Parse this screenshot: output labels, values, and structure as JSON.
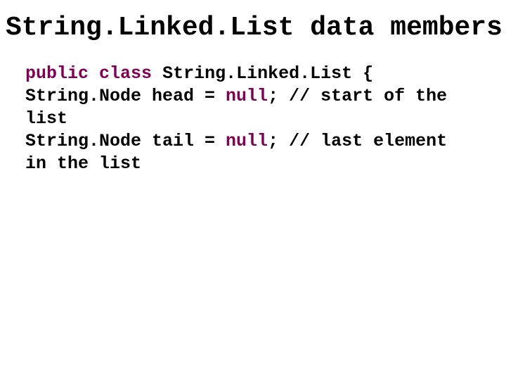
{
  "title": "String.Linked.List data members",
  "code": {
    "l1_kw1": "public",
    "l1_kw2": "class",
    "l1_cls": "String.Linked.List {",
    "l2_type": "String.Node head = ",
    "l2_kw": "null",
    "l2_rest": "; // start of the list",
    "l3_type": "String.Node tail = ",
    "l3_kw": "null",
    "l3_rest": "; // last element in the list"
  }
}
